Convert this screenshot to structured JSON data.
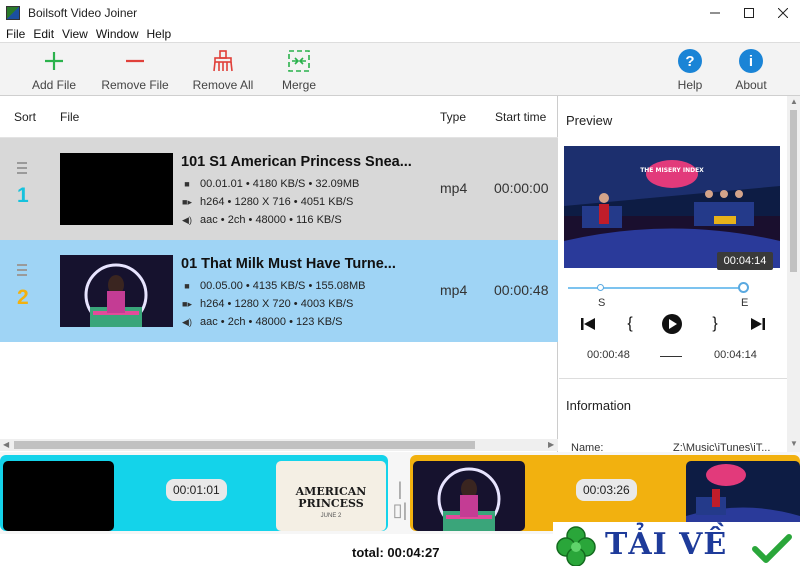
{
  "window": {
    "title": "Boilsoft Video Joiner"
  },
  "menu": [
    "File",
    "Edit",
    "View",
    "Window",
    "Help"
  ],
  "toolbar": {
    "add_file": "Add File",
    "remove_file": "Remove File",
    "remove_all": "Remove All",
    "merge": "Merge",
    "help": "Help",
    "about": "About",
    "help_glyph": "?",
    "about_glyph": "i"
  },
  "colors": {
    "accent": "#1a84d6",
    "row_selected": "#9fd4f5",
    "row_other": "#d8d8d8",
    "clip1": "#14d3ea",
    "clip2": "#f2b10f",
    "index1": "#16c2dd",
    "index2": "#f2b10f"
  },
  "list": {
    "headers": {
      "sort": "Sort",
      "file": "File",
      "type": "Type",
      "start_time": "Start time"
    },
    "rows": [
      {
        "index": "1",
        "name": "101 S1 American Princess Snea...",
        "duration": "00.01.01",
        "bitrate": "4180 KB/S",
        "size": "32.09MB",
        "video": "h264",
        "resolution": "1280 X 716",
        "video_rate": "4051 KB/S",
        "audio": "aac",
        "channels": "2ch",
        "sample": "48000",
        "audio_rate": "116 KB/S",
        "type": "mp4",
        "start": "00:00:00"
      },
      {
        "index": "2",
        "name": "01 That Milk Must Have Turne...",
        "duration": "00.05.00",
        "bitrate": "4135 KB/S",
        "size": "155.08MB",
        "video": "h264",
        "resolution": "1280 X 720",
        "video_rate": "4003 KB/S",
        "audio": "aac",
        "channels": "2ch",
        "sample": "48000",
        "audio_rate": "123 KB/S",
        "type": "mp4",
        "start": "00:00:48"
      }
    ]
  },
  "preview": {
    "title": "Preview",
    "tooltip_time": "00:04:14",
    "start_marker": "S",
    "end_marker": "E",
    "sel_start": "00:00:48",
    "sel_end": "00:04:14",
    "open_brace": "{",
    "close_brace": "}",
    "show_title": "THE MISERY INDEX"
  },
  "information": {
    "title": "Information",
    "name_label": "Name:",
    "name_value": "Z:\\Music\\iTunes\\iT..."
  },
  "timeline": {
    "clip1_duration": "00:01:01",
    "clip2_duration": "00:03:26",
    "clip1_card_title": "AMERICAN PRINCESS",
    "clip1_card_date": "JUNE 2"
  },
  "status": {
    "total": "total: 00:04:27"
  },
  "watermark": {
    "text": "TẢI VỀ"
  }
}
